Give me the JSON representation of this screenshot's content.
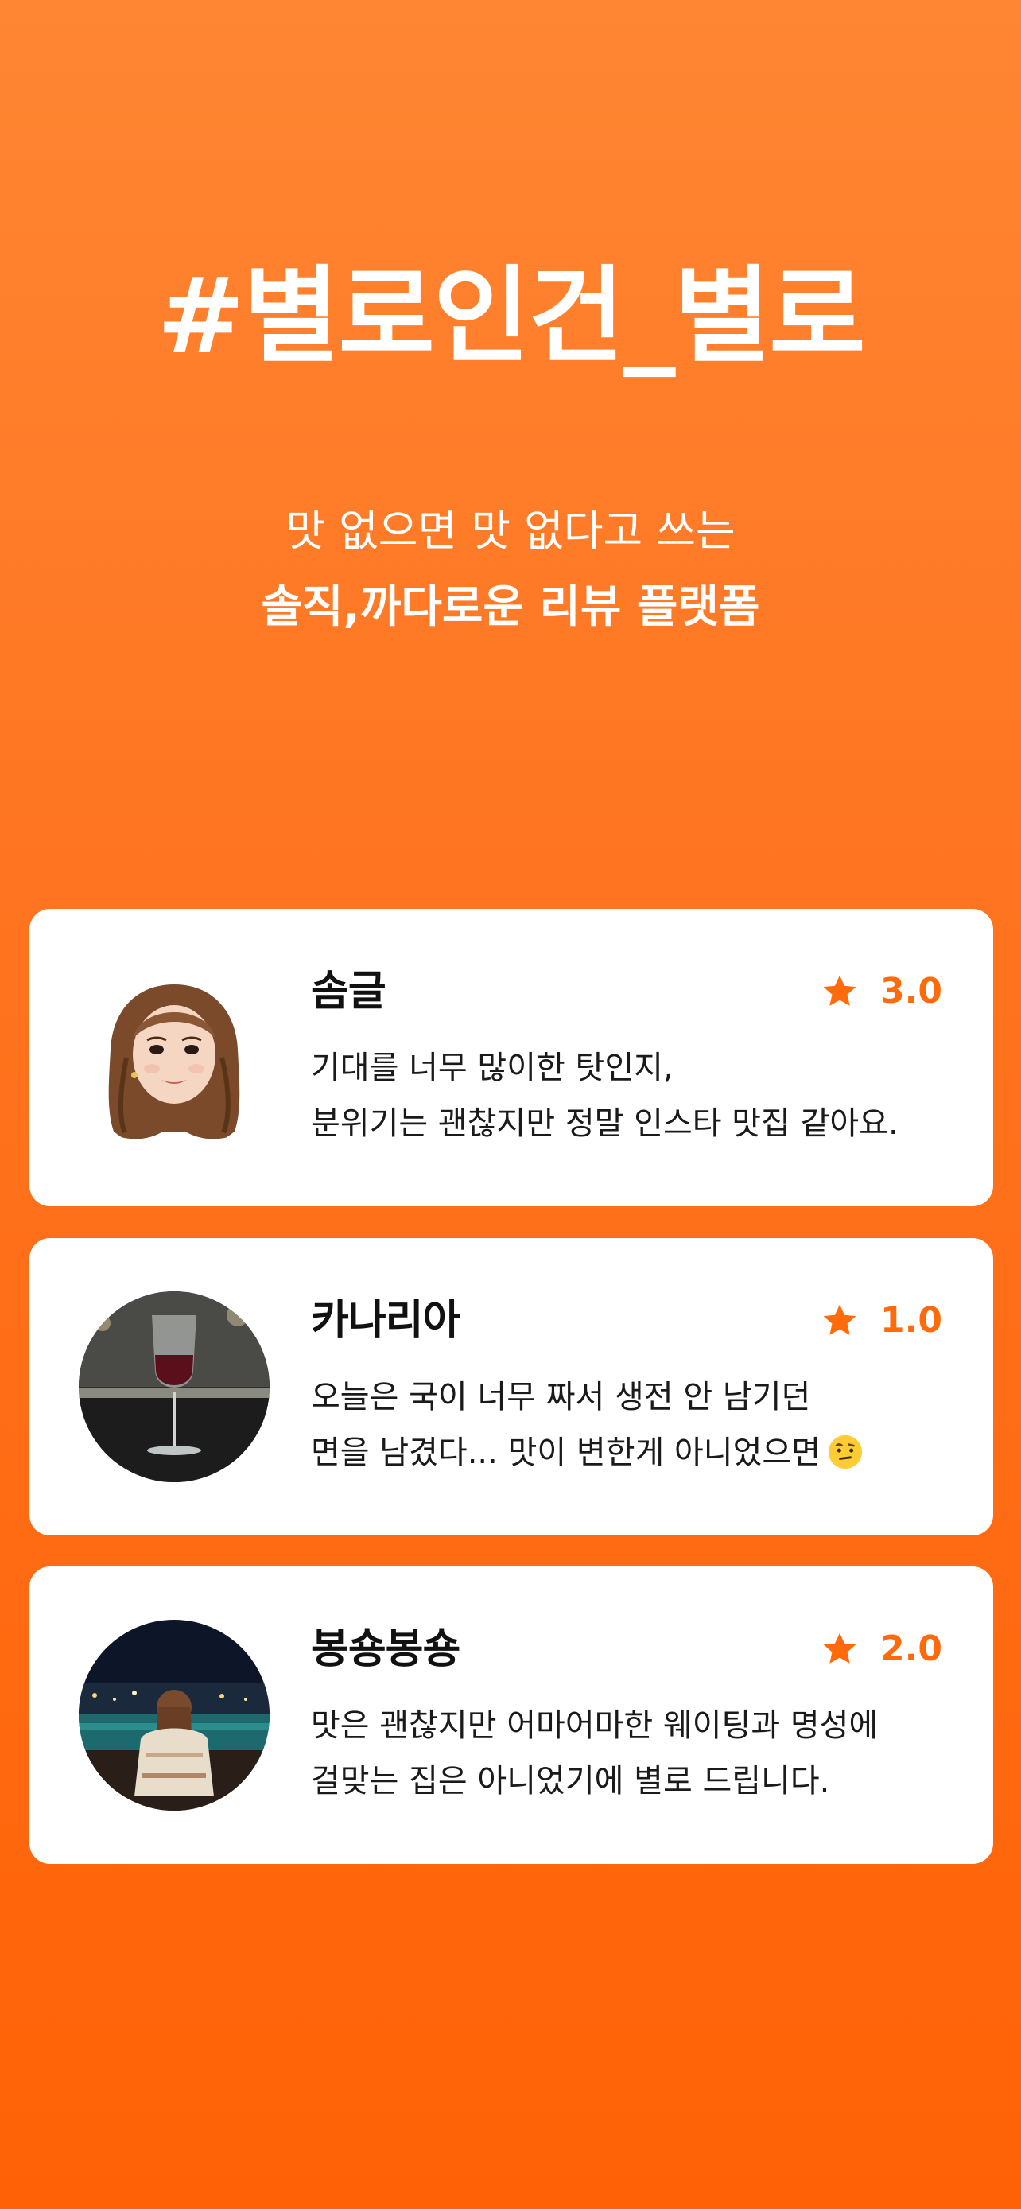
{
  "hero": {
    "title": "#별로인건_별로",
    "subtitle_line1": "맛 없으면 맛 없다고 쓰는",
    "subtitle_line2": "솔직,까다로운 리뷰 플랫폼"
  },
  "reviews": [
    {
      "name": "솜글",
      "rating": "3.0",
      "line1": "기대를 너무 많이한 탓인지,",
      "line2": "분위기는 괜찮지만 정말 인스타 맛집 같아요.",
      "avatar_icon": "memoji-woman-avatar"
    },
    {
      "name": "카나리아",
      "rating": "1.0",
      "line1": "오늘은 국이 너무 짜서 생전 안 남기던",
      "line2": "면을 남겼다... 맛이 변한게 아니었으면",
      "emoji_icon": "raised-eyebrow-face-icon",
      "avatar_icon": "wine-glass-photo-avatar"
    },
    {
      "name": "봉숑봉숑",
      "rating": "2.0",
      "line1": "맛은 괜찮지만 어마어마한 웨이팅과 명성에",
      "line2": "걸맞는 집은 아니었기에 별로 드립니다.",
      "avatar_icon": "night-view-photo-avatar"
    }
  ],
  "colors": {
    "accent": "#FF6B0B",
    "background_top": "#FF8633",
    "background_bottom": "#FF6206",
    "card": "#FFFFFF"
  }
}
